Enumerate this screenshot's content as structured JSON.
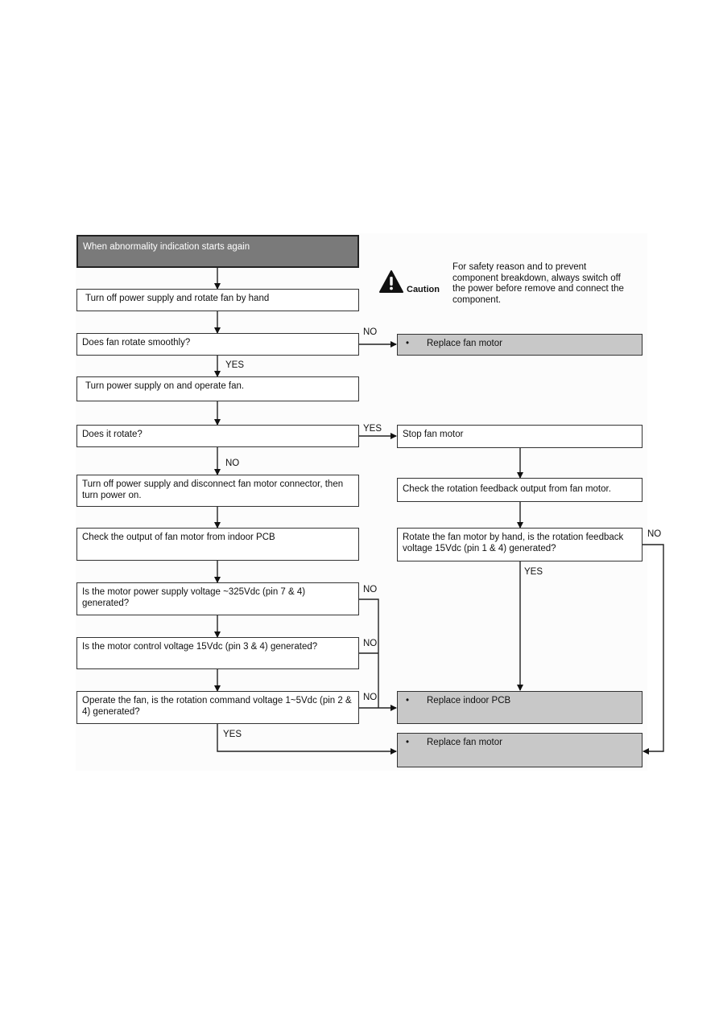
{
  "caution": {
    "icon": "warning-triangle-icon",
    "label": "Caution",
    "text": "For safety reason and to prevent component breakdown, always switch off the power before remove and connect the component."
  },
  "nodes": {
    "start": "When abnormality indication starts again",
    "turn_off_rotate": "Turn off power supply and rotate fan by hand",
    "rotate_smoothly": "Does fan rotate smoothly?",
    "replace_fan_motor_1": "Replace fan motor",
    "power_on_operate": "Turn power supply on and operate fan.",
    "does_it_rotate": "Does it rotate?",
    "stop_fan_motor": "Stop fan motor",
    "disconnect_connector": "Turn off power supply and disconnect fan motor connector, then turn power on.",
    "check_feedback": "Check the rotation feedback output from fan motor.",
    "check_output": "Check the output of fan motor from indoor PCB",
    "rotate_by_hand": "Rotate the fan motor by hand, is the rotation feedback voltage 15Vdc (pin 1 & 4) generated?",
    "power_supply_voltage": "Is the motor power supply voltage ~325Vdc (pin 7 & 4) generated?",
    "control_voltage": "Is the motor control voltage 15Vdc (pin 3 & 4) generated?",
    "command_voltage": "Operate the fan, is the rotation command voltage 1~5Vdc (pin 2 & 4) generated?",
    "replace_indoor_pcb": "Replace indoor PCB",
    "replace_fan_motor_2": "Replace fan motor"
  },
  "bullet": "•",
  "labels": {
    "yes": "YES",
    "no": "NO"
  }
}
